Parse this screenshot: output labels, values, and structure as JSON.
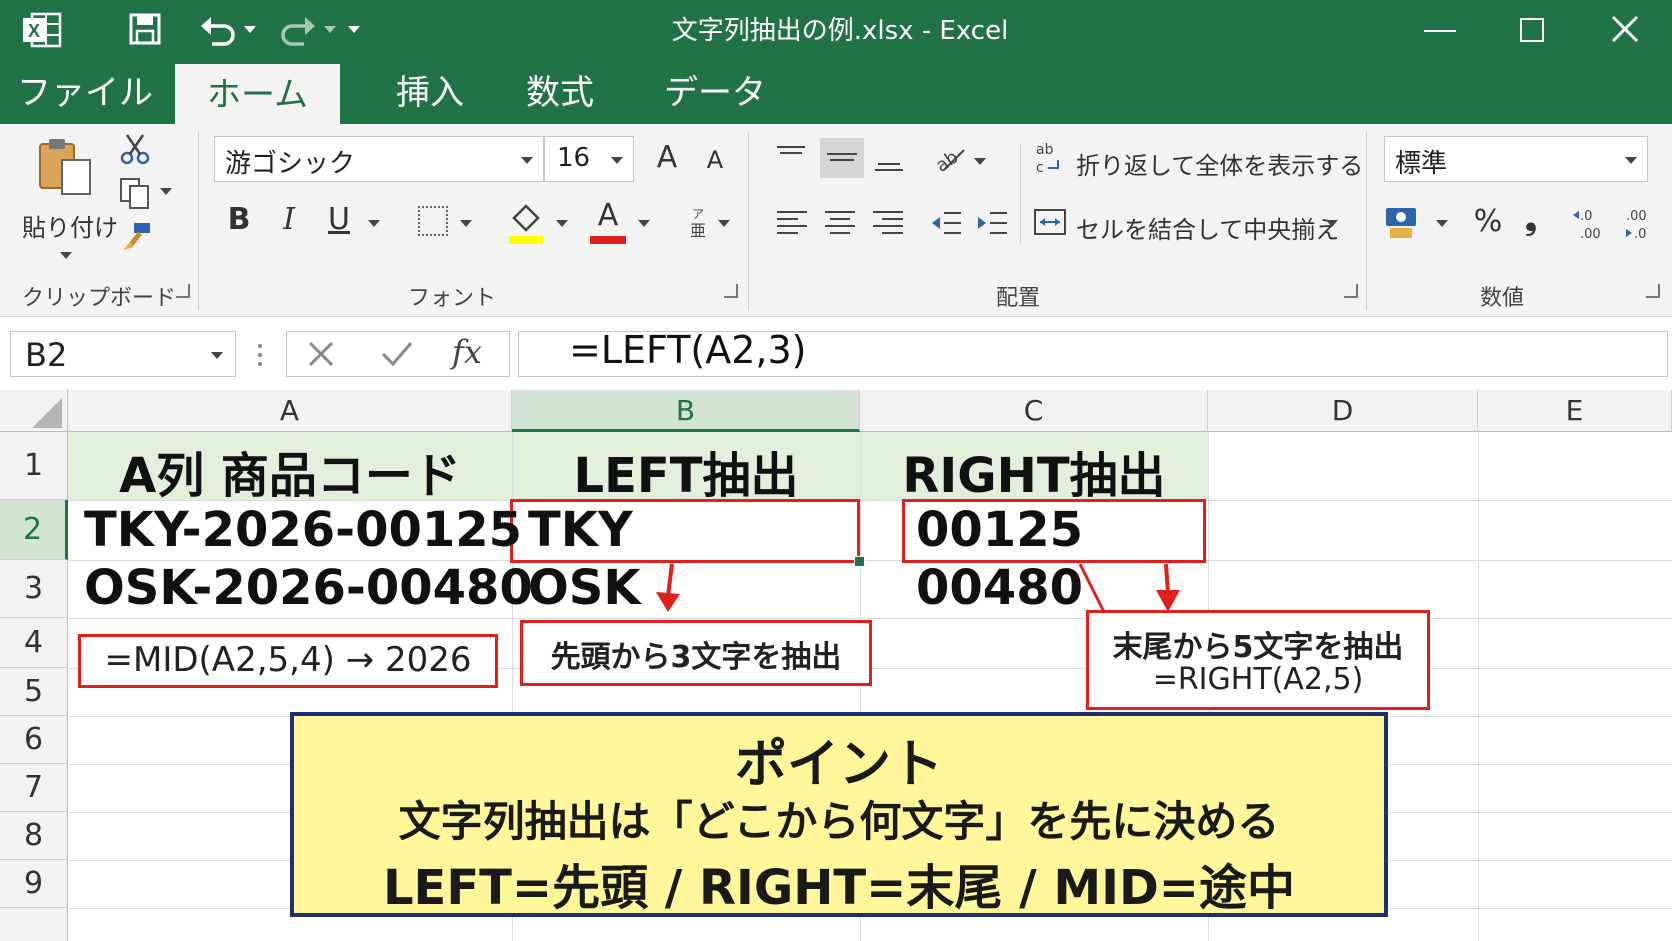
{
  "titlebar": {
    "title": "文字列抽出の例.xlsx - Excel",
    "app_icon": "excel-logo",
    "controls": [
      "minimize-icon",
      "maximize-icon",
      "close-icon"
    ]
  },
  "tabs": [
    {
      "label": "ファイル",
      "active": false
    },
    {
      "label": "ホーム",
      "active": true
    },
    {
      "label": "挿入",
      "active": false
    },
    {
      "label": "数式",
      "active": false
    },
    {
      "label": "データ",
      "active": false
    }
  ],
  "ribbon": {
    "clipboard": {
      "paste_label": "貼り付け",
      "group_label": "クリップボード"
    },
    "font": {
      "font_name": "游ゴシック",
      "font_size": "16",
      "bold": "B",
      "italic": "I",
      "underline": "U",
      "font_color_letter": "A",
      "grow": "A",
      "shrink": "A",
      "group_label": "フォント"
    },
    "alignment": {
      "wrap_label": "折り返して全体を表示する",
      "merge_label": "セルを結合して中央揃え",
      "wrap_icon_text": "ab",
      "group_label": "配置"
    },
    "number": {
      "format": "標準",
      "percent": "%",
      "comma": "❟",
      "inc_decimal": "←.0\n.00",
      "dec_decimal": ".00\n→.0",
      "group_label": "数値"
    }
  },
  "formula_bar": {
    "name_box": "B2",
    "fx": "fx",
    "formula": "=LEFT(A2,3)"
  },
  "columns": [
    "A",
    "B",
    "C",
    "D",
    "E"
  ],
  "rows": [
    "1",
    "2",
    "3",
    "4",
    "5",
    "6",
    "7",
    "8",
    "9"
  ],
  "cells": {
    "A1": "A列 商品コード",
    "B1": "LEFT抽出",
    "C1": "RIGHT抽出",
    "A2": "TKY-2026-00125",
    "B2": "TKY",
    "C2": "00125",
    "A3": "OSK-2026-00480",
    "B3": "OSK",
    "C3": "00480"
  },
  "annotations": {
    "mid_note": "=MID(A2,5,4) → 2026",
    "left_note": "先頭から3文字を抽出",
    "right_note_line1": "末尾から5文字を抽出",
    "right_note_line2": "=RIGHT(A2,5)"
  },
  "point_box": {
    "title": "ポイント",
    "line1": "文字列抽出は「どこから何文字」を先に決める",
    "line2": "LEFT=先頭 / RIGHT=末尾 / MID=途中"
  },
  "colors": {
    "excel_green": "#217346",
    "header_fill": "#e2efda",
    "annotation_red": "#e0201c",
    "point_fill": "#fff79a",
    "point_border": "#1c2f6e"
  }
}
